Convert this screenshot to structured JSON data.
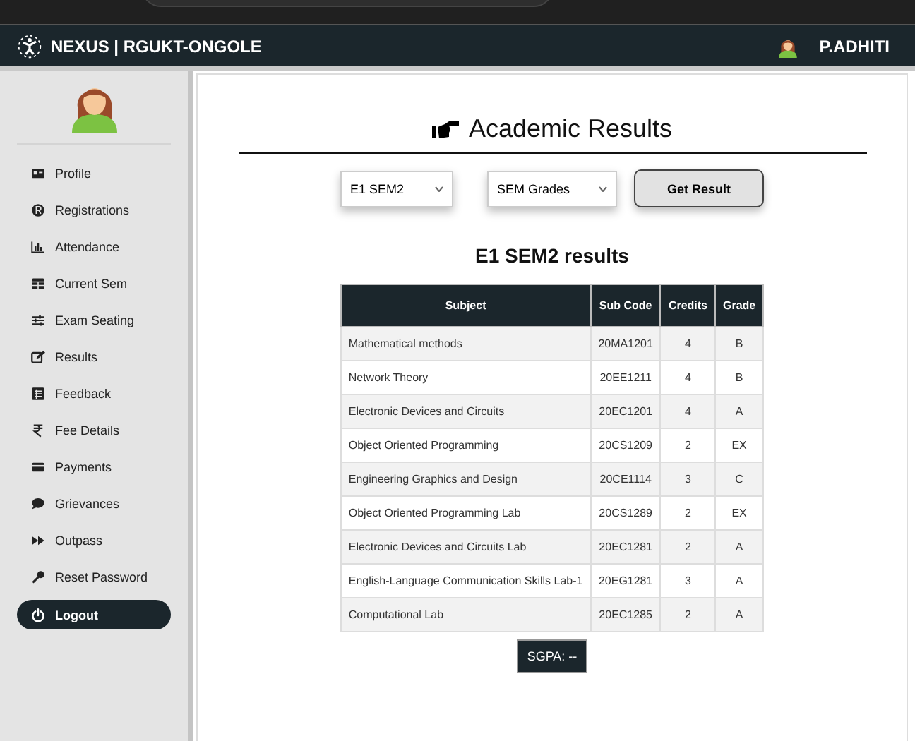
{
  "navbar": {
    "brand": "NEXUS | RGUKT-ONGOLE",
    "user": "P.ADHITI"
  },
  "sidebar": {
    "items": [
      {
        "label": "Profile",
        "kind": "link"
      },
      {
        "label": "Registrations",
        "kind": "link"
      },
      {
        "label": "Attendance",
        "kind": "link"
      },
      {
        "label": "Current Sem",
        "kind": "link"
      },
      {
        "label": "Exam Seating",
        "kind": "link"
      },
      {
        "label": "Results",
        "kind": "link"
      },
      {
        "label": "Feedback",
        "kind": "link"
      },
      {
        "label": "Fee Details",
        "kind": "link"
      },
      {
        "label": "Payments",
        "kind": "link"
      },
      {
        "label": "Grievances",
        "kind": "link"
      },
      {
        "label": "Outpass",
        "kind": "link"
      },
      {
        "label": "Reset Password",
        "kind": "link"
      },
      {
        "label": "Logout",
        "kind": "button"
      }
    ]
  },
  "main": {
    "title": "Academic Results",
    "semester_select": {
      "value": "E1 SEM2"
    },
    "type_select": {
      "value": "SEM Grades"
    },
    "submit_button": "Get Result",
    "results_heading": "E1 SEM2 results",
    "table": {
      "columns": [
        "Subject",
        "Sub Code",
        "Credits",
        "Grade"
      ],
      "rows": [
        [
          "Mathematical methods",
          "20MA1201",
          "4",
          "B"
        ],
        [
          "Network Theory",
          "20EE1211",
          "4",
          "B"
        ],
        [
          "Electronic Devices and Circuits",
          "20EC1201",
          "4",
          "A"
        ],
        [
          "Object Oriented Programming",
          "20CS1209",
          "2",
          "EX"
        ],
        [
          "Engineering Graphics and Design",
          "20CE1114",
          "3",
          "C"
        ],
        [
          "Object Oriented Programming Lab",
          "20CS1289",
          "2",
          "EX"
        ],
        [
          "Electronic Devices and Circuits Lab",
          "20EC1281",
          "2",
          "A"
        ],
        [
          "English-Language Communication Skills Lab-1",
          "20EG1281",
          "3",
          "A"
        ],
        [
          "Computational Lab",
          "20EC1285",
          "2",
          "A"
        ]
      ]
    },
    "sgpa": "SGPA: --"
  }
}
